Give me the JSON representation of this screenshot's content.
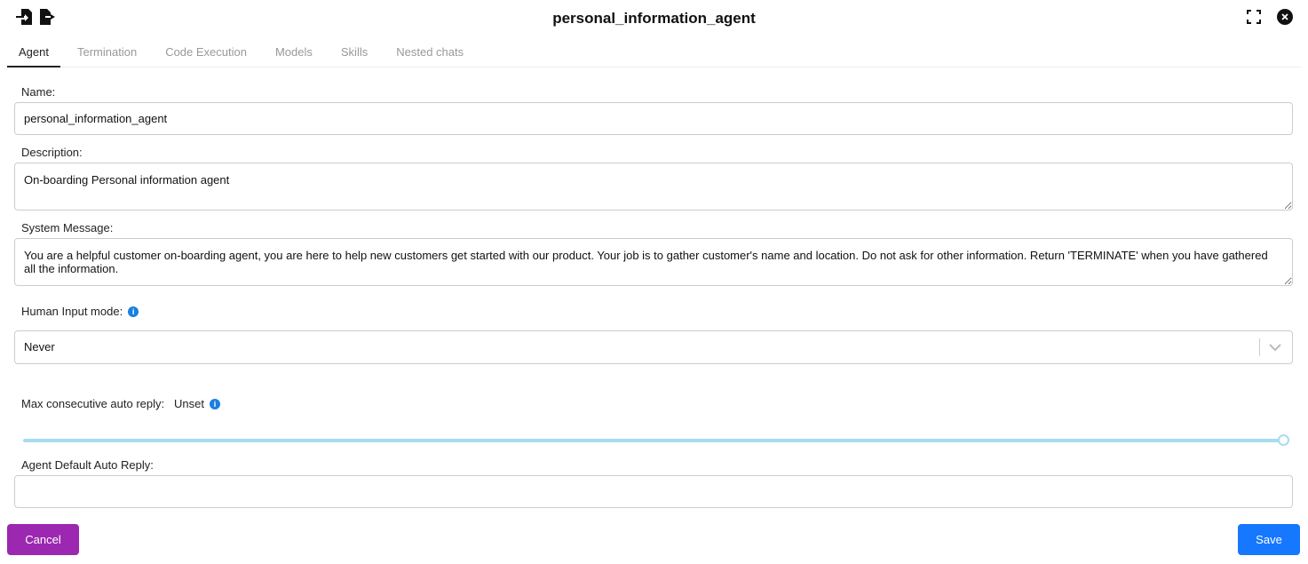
{
  "dialog": {
    "title": "personal_information_agent"
  },
  "icons": {
    "import": "file-import-icon",
    "export": "file-export-icon",
    "fullscreen": "fullscreen-icon",
    "close": "close-icon"
  },
  "tabs": [
    {
      "label": "Agent",
      "active": true
    },
    {
      "label": "Termination"
    },
    {
      "label": "Code Execution"
    },
    {
      "label": "Models"
    },
    {
      "label": "Skills"
    },
    {
      "label": "Nested chats"
    }
  ],
  "form": {
    "name_label": "Name:",
    "name_value": "personal_information_agent",
    "description_label": "Description:",
    "description_value": "On-boarding Personal information agent",
    "system_message_label": "System Message:",
    "system_message_value": "You are a helpful customer on-boarding agent, you are here to help new customers get started with our product. Your job is to gather customer's name and location. Do not ask for other information. Return 'TERMINATE' when you have gathered all the information.",
    "human_input_label": "Human Input mode:",
    "human_input_value": "Never",
    "max_reply_label": "Max consecutive auto reply:",
    "max_reply_value": "Unset",
    "max_reply_slider_percent": 100,
    "default_reply_label": "Agent Default Auto Reply:",
    "default_reply_value": ""
  },
  "buttons": {
    "cancel": "Cancel",
    "save": "Save"
  },
  "colors": {
    "cancel": "#9c27b0",
    "save": "#1677ff",
    "slider": "#a8dcef",
    "info": "#1a7fe0"
  }
}
